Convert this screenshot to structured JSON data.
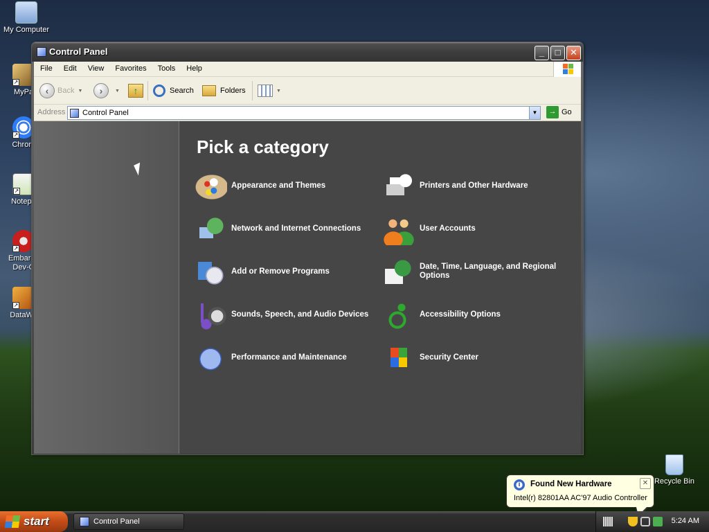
{
  "desktop": {
    "icons": [
      {
        "label": "My Computer",
        "icon": "my-computer-icon"
      },
      {
        "label": "MyPa",
        "icon": "documents-icon"
      },
      {
        "label": "Chrom",
        "icon": "chrome-icon"
      },
      {
        "label": "Notepa",
        "icon": "notepad-icon"
      },
      {
        "label": "Embarca",
        "label2": "Dev-C",
        "icon": "devcpp-icon"
      },
      {
        "label": "DataWa",
        "icon": "datawa-icon"
      }
    ],
    "recycle_bin": "Recycle Bin"
  },
  "window": {
    "title": "Control Panel",
    "controls": {
      "minimize": "_",
      "maximize": "□",
      "close": "✕"
    },
    "menu": [
      "File",
      "Edit",
      "View",
      "Favorites",
      "Tools",
      "Help"
    ],
    "toolbar": {
      "back": "Back",
      "search": "Search",
      "folders": "Folders"
    },
    "address": {
      "label": "Address",
      "value": "Control Panel",
      "go": "Go"
    },
    "main": {
      "heading": "Pick a category",
      "categories_left": [
        {
          "label": "Appearance and Themes",
          "icon": "appearance-themes-icon"
        },
        {
          "label": "Network and Internet Connections",
          "icon": "network-icon"
        },
        {
          "label": "Add or Remove Programs",
          "icon": "add-remove-programs-icon"
        },
        {
          "label": "Sounds, Speech, and Audio Devices",
          "icon": "sounds-icon"
        },
        {
          "label": "Performance and Maintenance",
          "icon": "performance-icon"
        }
      ],
      "categories_right": [
        {
          "label": "Printers and Other Hardware",
          "icon": "printers-icon"
        },
        {
          "label": "User Accounts",
          "icon": "user-accounts-icon"
        },
        {
          "label": "Date, Time, Language, and Regional Options",
          "icon": "date-time-icon"
        },
        {
          "label": "Accessibility Options",
          "icon": "accessibility-icon"
        },
        {
          "label": "Security Center",
          "icon": "security-center-icon"
        }
      ]
    }
  },
  "taskbar": {
    "start": "start",
    "task": "Control Panel",
    "clock": "5:24 AM"
  },
  "balloon": {
    "title": "Found New Hardware",
    "text": "Intel(r) 82801AA AC'97 Audio Controller",
    "info_icon": "i",
    "close": "✕"
  },
  "colors": {
    "window_frame": "#3c3c3c",
    "content_bg": "#464646",
    "start_orange": "#c24b17",
    "balloon_bg": "#ffffe1"
  }
}
